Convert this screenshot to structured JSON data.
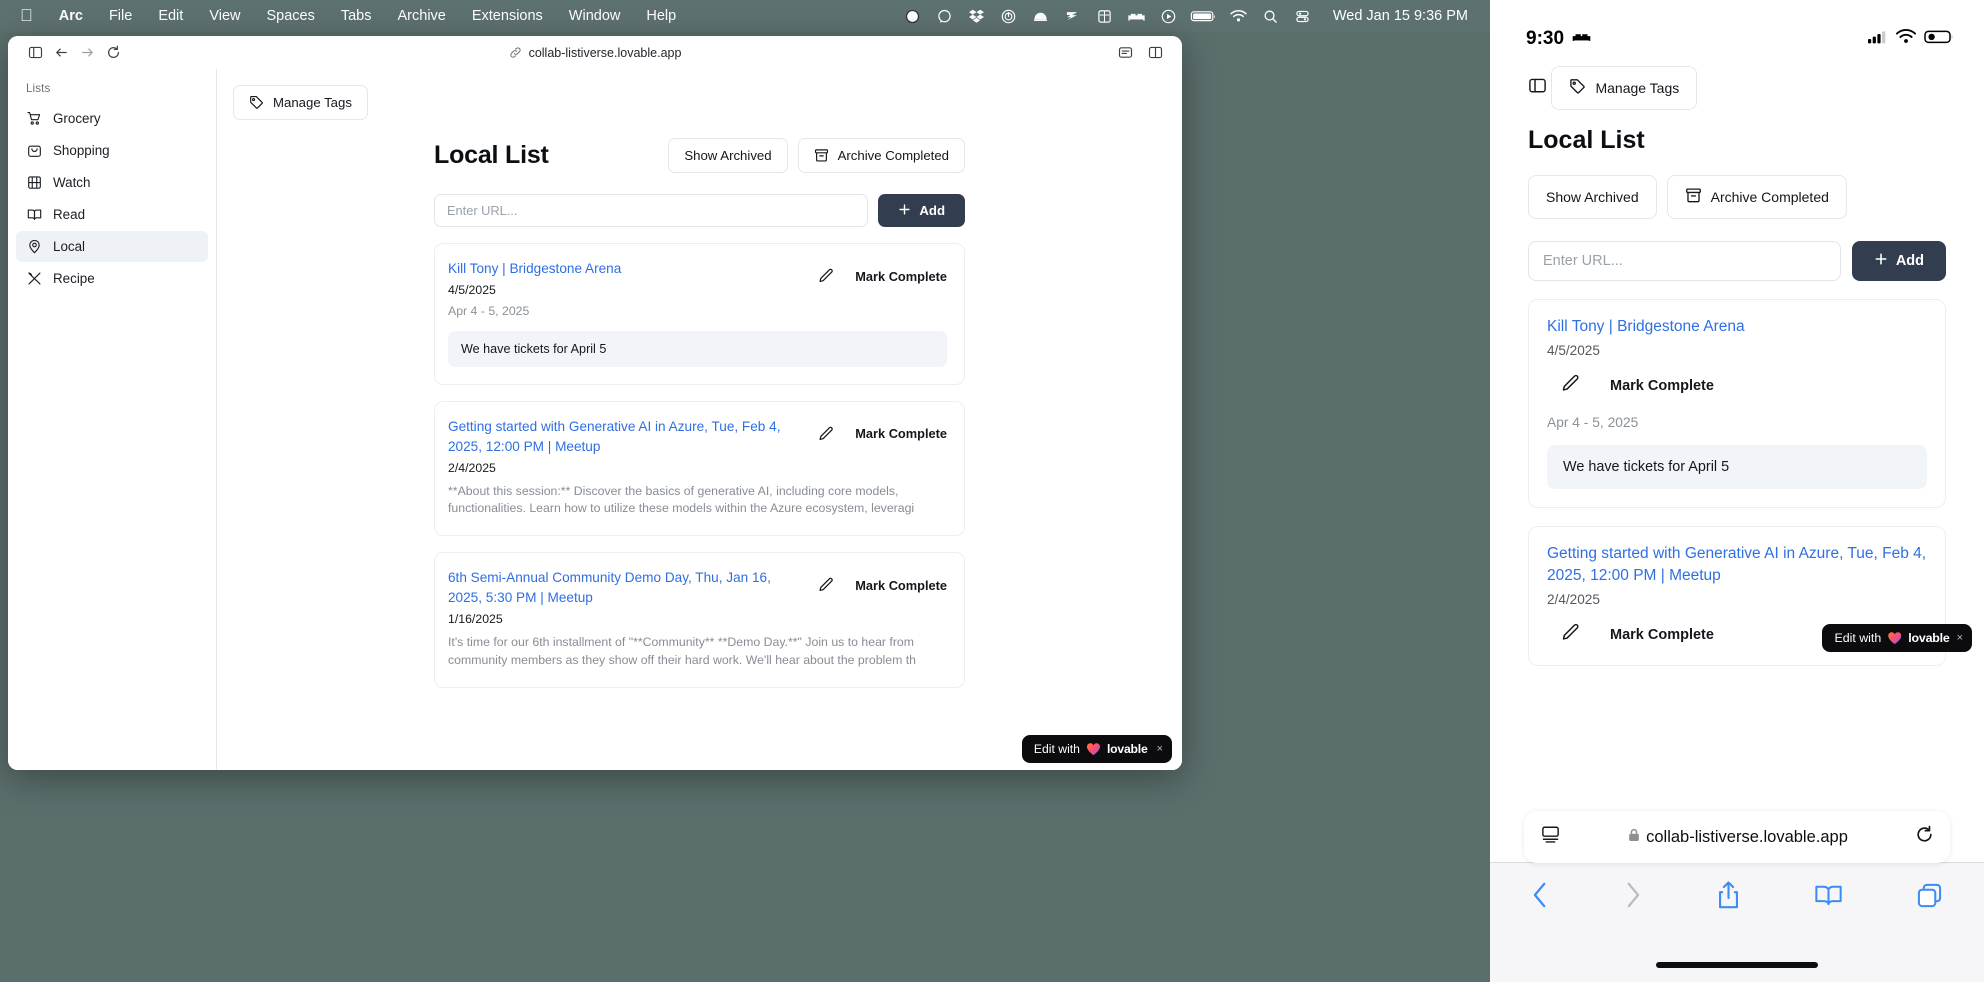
{
  "macos": {
    "menu": {
      "apple_icon": "apple-logo-icon",
      "items": [
        "Arc",
        "File",
        "Edit",
        "View",
        "Spaces",
        "Tabs",
        "Archive",
        "Extensions",
        "Window",
        "Help"
      ],
      "tray_icons": [
        "record-circle-icon",
        "speech-bubble-icon",
        "dropbox-icon",
        "power-circle-icon",
        "bell-dome-icon",
        "zap-lines-icon",
        "frame-grid-icon",
        "bed-icon",
        "play-circle-icon",
        "battery-icon",
        "wifi-icon",
        "search-icon",
        "control-center-icon"
      ],
      "clock": "Wed Jan 15  9:36 PM"
    }
  },
  "browser": {
    "toolbar": {
      "sidebar_toggle_icon": "sidebar-toggle-icon",
      "back_icon": "arrow-left-icon",
      "forward_icon": "arrow-right-icon",
      "reload_icon": "reload-icon",
      "link_icon": "link-icon",
      "url": "collab-listiverse.lovable.app",
      "note_icon": "note-panel-icon",
      "split_icon": "split-view-icon"
    }
  },
  "sidebar": {
    "heading": "Lists",
    "items": [
      {
        "label": "Grocery",
        "icon": "shopping-cart-icon",
        "active": false
      },
      {
        "label": "Shopping",
        "icon": "shopping-bag-icon",
        "active": false
      },
      {
        "label": "Watch",
        "icon": "film-icon",
        "active": false
      },
      {
        "label": "Read",
        "icon": "book-open-icon",
        "active": false
      },
      {
        "label": "Local",
        "icon": "map-pin-icon",
        "active": true
      },
      {
        "label": "Recipe",
        "icon": "utensils-crossed-icon",
        "active": false
      }
    ]
  },
  "app": {
    "manage_tags_label": "Manage Tags",
    "manage_tags_icon": "tag-icon",
    "page_title": "Local List",
    "show_archived_label": "Show Archived",
    "archive_completed_label": "Archive Completed",
    "archive_icon": "archive-box-icon",
    "url_placeholder": "Enter URL...",
    "url_value": "",
    "add_label": "Add",
    "add_icon": "plus-icon",
    "edit_icon": "pencil-icon",
    "mark_complete_label": "Mark Complete",
    "cards": [
      {
        "title": "Kill Tony | Bridgestone Arena",
        "date": "4/5/2025",
        "subtitle": "Apr 4 - 5, 2025",
        "note": "We have tickets for April 5",
        "description": ""
      },
      {
        "title": "Getting started with Generative AI in Azure, Tue, Feb 4, 2025, 12:00 PM | Meetup",
        "date": "2/4/2025",
        "subtitle": "",
        "note": "",
        "description": "**About this session:** Discover the basics of generative AI, including core models, functionalities. Learn how to utilize these models within the Azure ecosystem, leveragi"
      },
      {
        "title": "6th Semi-Annual Community Demo Day, Thu, Jan 16, 2025, 5:30 PM | Meetup",
        "date": "1/16/2025",
        "subtitle": "",
        "note": "",
        "description": "It's time for our 6th installment of \"**Community** **Demo Day.**\" Join us to hear from community members as they show off their hard work. We'll hear about the problem th"
      }
    ],
    "badge": {
      "prefix": "Edit with",
      "brand": "lovable",
      "close": "×",
      "heart_icon": "heart-icon"
    }
  },
  "phone": {
    "status": {
      "time": "9:30",
      "sleep_icon": "bed-icon",
      "signal_icon": "cellular-bars-icon",
      "wifi_icon": "wifi-icon",
      "battery_icon": "battery-low-icon"
    },
    "sidebar_toggle_icon": "sidebar-toggle-icon",
    "manage_tags_label": "Manage Tags",
    "page_title": "Local List",
    "show_archived_label": "Show Archived",
    "archive_completed_label": "Archive Completed",
    "url_placeholder": "Enter URL...",
    "add_label": "Add",
    "mark_complete_label": "Mark Complete",
    "cards": [
      {
        "title": "Kill Tony | Bridgestone Arena",
        "date": "4/5/2025",
        "subtitle": "Apr 4 - 5, 2025",
        "note": "We have tickets for April 5"
      },
      {
        "title": "Getting started with Generative AI in Azure, Tue, Feb 4, 2025, 12:00 PM | Meetup",
        "date": "2/4/2025",
        "subtitle": "",
        "note": ""
      }
    ],
    "badge": {
      "prefix": "Edit with",
      "brand": "lovable",
      "close": "×"
    },
    "safari": {
      "reader_icon": "reader-view-icon",
      "lock_icon": "lock-icon",
      "url": "collab-listiverse.lovable.app",
      "reload_icon": "reload-icon",
      "back_icon": "chevron-left-icon",
      "forward_icon": "chevron-right-icon",
      "share_icon": "share-icon",
      "bookmarks_icon": "book-icon",
      "tabs_icon": "tabs-icon"
    }
  },
  "colors": {
    "accent_link": "#2f6fe4",
    "add_button": "#323e4f",
    "note_bg": "#f1f4f8",
    "menubar": "#5d7170"
  }
}
